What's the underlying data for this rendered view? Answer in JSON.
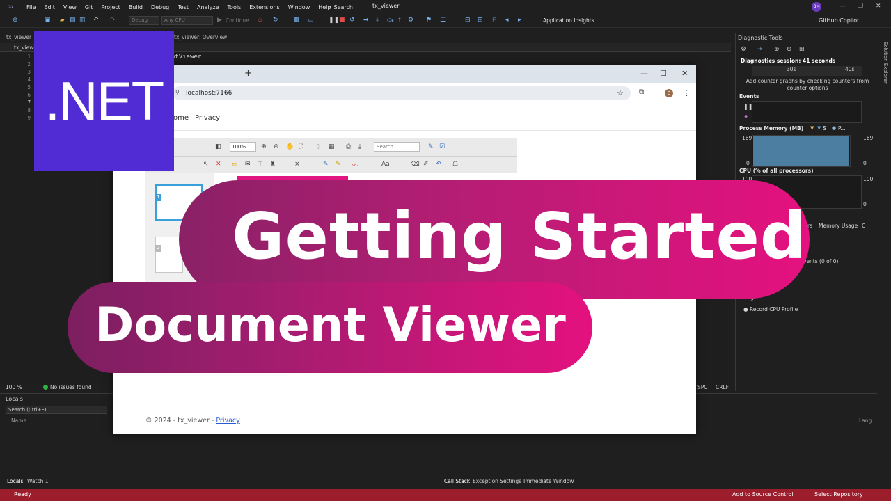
{
  "menu": [
    "File",
    "Edit",
    "View",
    "Git",
    "Project",
    "Build",
    "Debug",
    "Test",
    "Analyze",
    "Tools",
    "Extensions",
    "Window",
    "Help"
  ],
  "search_label": "Search",
  "solution_name": "tx_viewer",
  "user_initials": "BM",
  "toolbar": {
    "config": "Debug",
    "platform": "Any CPU",
    "continue": "Continue",
    "app_insights": "Application Insights",
    "copilot": "GitHub Copilot"
  },
  "doc_tabs": [
    "tx_viewer",
    "tx_viewer: Overview"
  ],
  "editor": {
    "project_dropdown": "tx_viewe",
    "line_numbers": [
      "1",
      "2",
      "3",
      "4",
      "5",
      "6",
      "7",
      "8",
      "9"
    ],
    "code_fragment": "ntViewer",
    "zoom": "100 %",
    "issues": "No issues found",
    "spc": "SPC",
    "crlf": "CRLF"
  },
  "locals": {
    "title": "Locals",
    "search_placeholder": "Search (Ctrl+E)",
    "name_col": "Name",
    "lang_col": "Lang"
  },
  "bottom_tabs_left": [
    "Locals",
    "Watch 1"
  ],
  "bottom_tabs_right": [
    "Call Stack",
    "Exception Settings",
    "Immediate Window"
  ],
  "status": {
    "ready": "Ready",
    "source_control": "Add to Source Control",
    "select_repo": "Select Repository",
    "bar_color": "#9c1d2c"
  },
  "diagnostics": {
    "title": "Diagnostic Tools",
    "session": "Diagnostics session: 41 seconds",
    "tick_30": "30s",
    "tick_40": "40s",
    "hint": "Add counter graphs by checking counters from counter options",
    "events": "Events",
    "process_memory": "Process Memory (MB)",
    "mem_legend": "S",
    "mem_legend_2": "P...",
    "mem_max": "169",
    "mem_min": "0",
    "cpu": "CPU (% of all processors)",
    "cpu_max": "100",
    "cpu_min": "0",
    "memory_usage_tab": "Memory Usage",
    "tab_fragment": "rs",
    "tab_fragment_2": "C",
    "events_count": "vents (0 of 0)",
    "section_fragment": "Usage",
    "record_cpu": "Record CPU Profile",
    "solution_explorer": "Solution Explorer"
  },
  "browser": {
    "url": "localhost:7166",
    "profile_initial": "B",
    "nav_home": "ome",
    "nav_privacy": "Privacy",
    "zoom": "100%",
    "search_placeholder": "Search...",
    "page_1": "1",
    "page_2": "2",
    "footer_prefix": "© 2024 - tx_viewer - ",
    "footer_link": "Privacy"
  },
  "badge": {
    "text": ".NET",
    "color": "#512bd4"
  },
  "banner": {
    "line1": "Getting Started",
    "line2": "Document Viewer",
    "accent": "#e4117f"
  }
}
